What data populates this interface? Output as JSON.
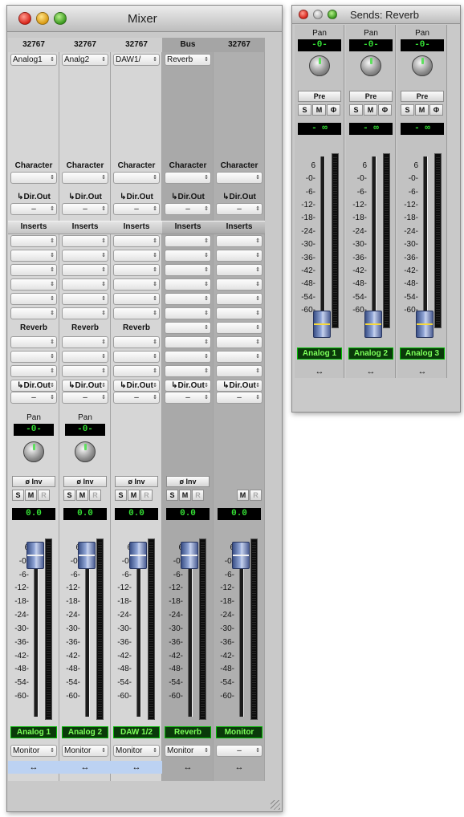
{
  "mixer": {
    "title": "Mixer",
    "strips": [
      {
        "id": "s1",
        "type": "input",
        "header": "32767",
        "input": "Analog1",
        "character_label": "Character",
        "dirout1_label": "↳Dir.Out",
        "dirout1_value": "–",
        "inserts_label": "Inserts",
        "insert_slots": [
          "",
          "",
          "",
          "",
          "",
          ""
        ],
        "send_label": "Reverb",
        "send_slots": [
          "",
          "",
          "",
          ""
        ],
        "dirout2_label": "↳Dir.Out",
        "dirout2_value": "–",
        "pan_label": "Pan",
        "pan_value": "-0-",
        "phase_label": "ø Inv",
        "solo": "S",
        "mute": "M",
        "rec": "R",
        "level": "0.0",
        "name": "Analog 1",
        "monitor": "Monitor",
        "link_icon": "↔",
        "link_active": true
      },
      {
        "id": "s2",
        "type": "input",
        "header": "32767",
        "input": "Analg2",
        "character_label": "Character",
        "dirout1_label": "↳Dir.Out",
        "dirout1_value": "–",
        "inserts_label": "Inserts",
        "insert_slots": [
          "",
          "",
          "",
          "",
          "",
          ""
        ],
        "send_label": "Reverb",
        "send_slots": [
          "",
          "",
          "",
          ""
        ],
        "dirout2_label": "↳Dir.Out",
        "dirout2_value": "–",
        "pan_label": "Pan",
        "pan_value": "-0-",
        "phase_label": "ø Inv",
        "solo": "S",
        "mute": "M",
        "rec": "R",
        "level": "0.0",
        "name": "Analog 2",
        "monitor": "Monitor",
        "link_icon": "↔",
        "link_active": true
      },
      {
        "id": "s3",
        "type": "input",
        "header": "32767",
        "input": "DAW1/",
        "character_label": "Character",
        "dirout1_label": "↳Dir.Out",
        "dirout1_value": "–",
        "inserts_label": "Inserts",
        "insert_slots": [
          "",
          "",
          "",
          "",
          "",
          ""
        ],
        "send_label": "Reverb",
        "send_slots": [
          "",
          "",
          "",
          ""
        ],
        "dirout2_label": "↳Dir.Out",
        "dirout2_value": "–",
        "pan_label": "",
        "pan_value": "",
        "phase_label": "ø Inv",
        "solo": "S",
        "mute": "M",
        "rec": "R",
        "level": "0.0",
        "name": "DAW 1/2",
        "monitor": "Monitor",
        "link_icon": "↔",
        "link_active": true
      },
      {
        "id": "s4",
        "type": "bus",
        "header": "Bus",
        "input": "Reverb",
        "character_label": "Character",
        "dirout1_label": "↳Dir.Out",
        "dirout1_value": "–",
        "inserts_label": "Inserts",
        "insert_slots": [
          "",
          "",
          "",
          "",
          "",
          ""
        ],
        "send_label": "",
        "send_slots": [
          "",
          "",
          "",
          "",
          ""
        ],
        "dirout2_label": "↳Dir.Out",
        "dirout2_value": "–",
        "pan_label": "",
        "pan_value": "",
        "phase_label": "ø Inv",
        "solo": "S",
        "mute": "M",
        "rec": "R",
        "level": "0.0",
        "name": "Reverb",
        "monitor": "Monitor",
        "link_icon": "↔",
        "link_active": false
      },
      {
        "id": "s5",
        "type": "mon",
        "header": "32767",
        "input": "",
        "character_label": "Character",
        "dirout1_label": "↳Dir.Out",
        "dirout1_value": "–",
        "inserts_label": "Inserts",
        "insert_slots": [
          "",
          "",
          "",
          "",
          "",
          ""
        ],
        "send_label": "",
        "send_slots": [
          "",
          "",
          "",
          "",
          ""
        ],
        "dirout2_label": "↳Dir.Out",
        "dirout2_value": "–",
        "pan_label": "",
        "pan_value": "",
        "phase_label": "",
        "solo": "",
        "mute": "M",
        "rec": "R",
        "level": "0.0",
        "name": "Monitor",
        "monitor": "–",
        "link_icon": "↔",
        "link_active": false
      }
    ],
    "fader_scale": [
      "6",
      "-0-",
      "-6-",
      "-12-",
      "-18-",
      "-24-",
      "-30-",
      "-36-",
      "-42-",
      "-48-",
      "-54-",
      "-60-"
    ]
  },
  "sends": {
    "title": "Sends: Reverb",
    "channels": [
      {
        "pan_label": "Pan",
        "pan_value": "-0-",
        "pre": "Pre",
        "solo": "S",
        "mute": "M",
        "phase": "Φ",
        "level": "- ∞",
        "name": "Analog 1",
        "link_icon": "↔"
      },
      {
        "pan_label": "Pan",
        "pan_value": "-0-",
        "pre": "Pre",
        "solo": "S",
        "mute": "M",
        "phase": "Φ",
        "level": "- ∞",
        "name": "Analog 2",
        "link_icon": "↔"
      },
      {
        "pan_label": "Pan",
        "pan_value": "-0-",
        "pre": "Pre",
        "solo": "S",
        "mute": "M",
        "phase": "Φ",
        "level": "- ∞",
        "name": "Analog 3",
        "link_icon": "↔"
      }
    ],
    "fader_scale": [
      "6",
      "-0-",
      "-6-",
      "-12-",
      "-18-",
      "-24-",
      "-30-",
      "-36-",
      "-42-",
      "-48-",
      "-54-",
      "-60-"
    ]
  },
  "colors": {
    "lcd_text": "#35e035",
    "name_text": "#7cff5a",
    "link_active": "#bcd2f2",
    "fader": "#93a8d8"
  }
}
